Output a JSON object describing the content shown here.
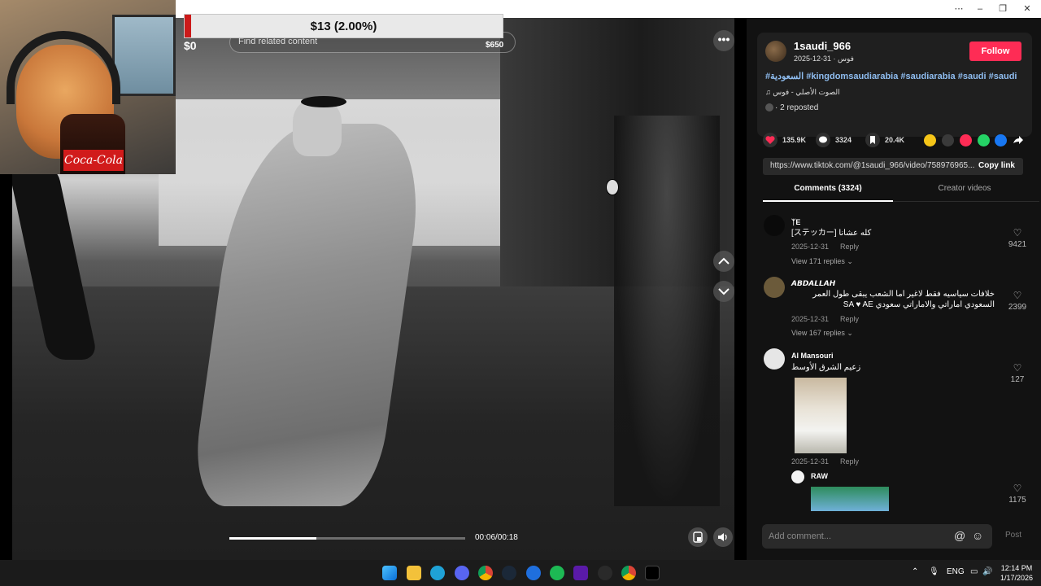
{
  "stream_overlay": {
    "donation_goal": "$13 (2.00%)",
    "goal_fill_fraction": 0.02,
    "goal_min": "$0",
    "goal_max": "$650",
    "search_placeholder": "Find related content",
    "webcam_bottle_label": "Coca-Cola"
  },
  "video": {
    "time": "00:06/00:18",
    "progress_fraction": 0.37
  },
  "author": {
    "name": "1saudi_966",
    "date": "2025-12-31 · فوس",
    "follow_label": "Follow",
    "hashtags": "#السعودية #kingdomsaudiarabia #saudiarabia #saudi #saudi",
    "sound": "♫  الصوت الأصلي - فوس",
    "reposted": "· 2 reposted"
  },
  "stats": {
    "likes": "135.9K",
    "comments": "3324",
    "saves": "20.4K"
  },
  "share_colors": [
    "#f5c518",
    "#444444",
    "#fe2c55",
    "#25d366",
    "#1877f2"
  ],
  "link": {
    "url": "https://www.tiktok.com/@1saudi_966/video/758976965...",
    "copy_label": "Copy link"
  },
  "tabs": {
    "comments": "Comments (3324)",
    "creator": "Creator videos"
  },
  "comments": [
    {
      "user": "ᛉE",
      "text": "[ステッカー] كله عشانا",
      "date": "2025-12-31",
      "reply_label": "Reply",
      "view_replies": "View 171 replies ⌄",
      "likes": "9421",
      "avatar_color": "#0a0a0a"
    },
    {
      "user": "𝘼𝘽𝘿𝘼𝙇𝙇𝘼𝙃",
      "text": "خلافات سياسيه فقط لاغير اما الشعب يبقى طول العمر السعودي اماراتي والاماراتي سعودي SA ♥ AE",
      "date": "2025-12-31",
      "reply_label": "Reply",
      "view_replies": "View 167 replies ⌄",
      "likes": "2399",
      "avatar_color": "#6b5a3a"
    },
    {
      "user": "Al Mansouri",
      "text": "زعيم الشرق الأوسط",
      "date": "2025-12-31",
      "reply_label": "Reply",
      "likes": "127",
      "avatar_color": "#e6e6e6"
    },
    {
      "user": "RAW",
      "likes": "1175",
      "avatar_color": "#f2f2f2"
    }
  ],
  "comment_input": {
    "placeholder": "Add comment...",
    "post_label": "Post"
  },
  "taskbar": {
    "lang": "ENG",
    "time": "12:14 PM",
    "date": "1/17/2026"
  },
  "window_controls": [
    "⋯",
    "–",
    "❐",
    "✕"
  ]
}
